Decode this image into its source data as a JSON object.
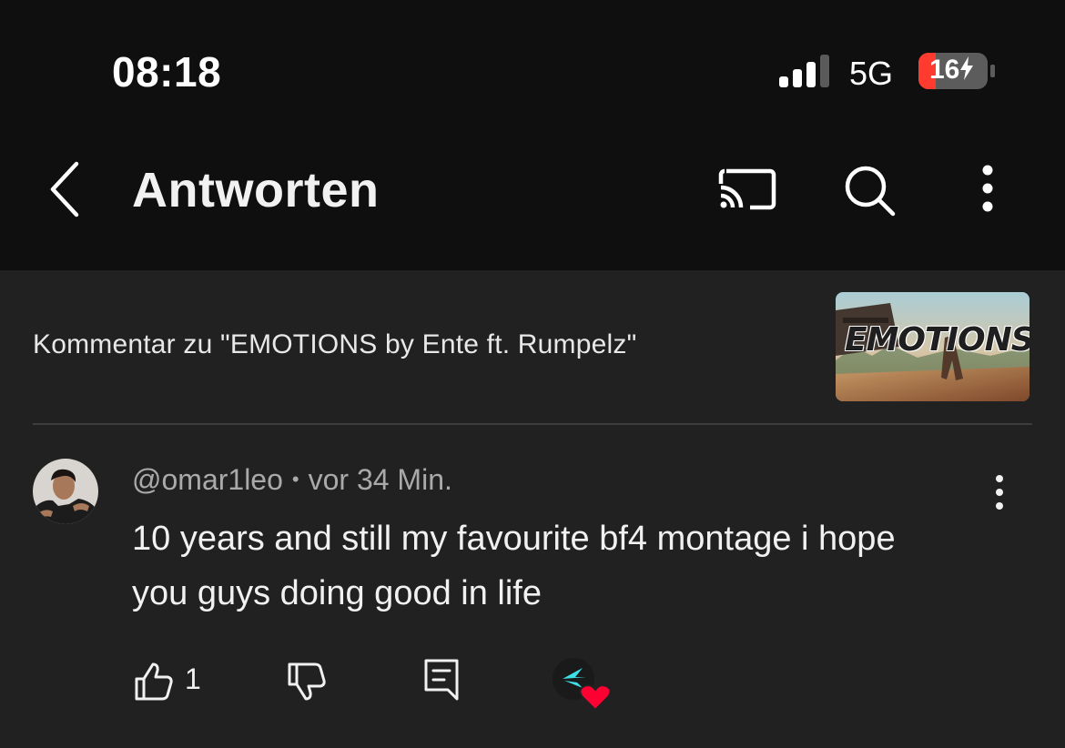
{
  "status_bar": {
    "time": "08:18",
    "network": "5G",
    "battery": "16"
  },
  "header": {
    "title": "Antworten",
    "icons": [
      "back-icon",
      "cast-icon",
      "search-icon",
      "more-vertical-icon"
    ]
  },
  "context": {
    "label": "Kommentar zu \"EMOTIONS by Ente ft. Rumpelz\"",
    "thumbnail_text": "EMOTIONS"
  },
  "comment": {
    "author": "@omar1leo",
    "separator": "•",
    "time": "vor 34 Min.",
    "text": "10 years and still my favourite bf4 montage i hope you guys doing good in life",
    "like_count": "1"
  },
  "colors": {
    "background": "#212121",
    "header_bg": "#0f0f0f",
    "battery_low": "#ff3b30",
    "heart": "#ff0033",
    "creator_accent": "#3ee0e8"
  }
}
